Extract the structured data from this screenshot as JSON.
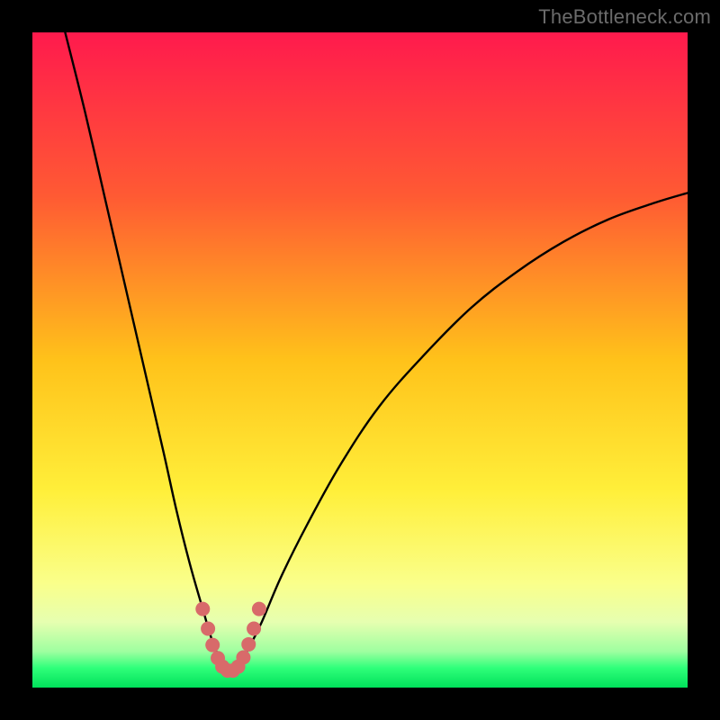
{
  "watermark": "TheBottleneck.com",
  "colors": {
    "frame": "#000000",
    "gradient_stops": [
      {
        "offset": 0.0,
        "color": "#ff1a4d"
      },
      {
        "offset": 0.25,
        "color": "#ff5a33"
      },
      {
        "offset": 0.5,
        "color": "#ffc21a"
      },
      {
        "offset": 0.7,
        "color": "#ffef3a"
      },
      {
        "offset": 0.84,
        "color": "#faff8a"
      },
      {
        "offset": 0.9,
        "color": "#e6ffb0"
      },
      {
        "offset": 0.945,
        "color": "#9effa0"
      },
      {
        "offset": 0.97,
        "color": "#2fff7a"
      },
      {
        "offset": 1.0,
        "color": "#00e05a"
      }
    ],
    "curve": "#000000",
    "dots": "#d86a6a"
  },
  "chart_data": {
    "type": "line",
    "title": "",
    "xlabel": "",
    "ylabel": "",
    "xlim": [
      0,
      100
    ],
    "ylim": [
      0,
      100
    ],
    "series": [
      {
        "name": "bottleneck-curve",
        "x": [
          5,
          8,
          11,
          14,
          17,
          20,
          22,
          24,
          26,
          27.5,
          29,
          30,
          31.5,
          33,
          35,
          38,
          42,
          47,
          53,
          60,
          67,
          74,
          81,
          88,
          95,
          100
        ],
        "y": [
          100,
          88,
          75,
          62,
          49,
          36,
          27,
          19,
          12,
          7,
          3.5,
          2.5,
          3.5,
          6,
          10,
          17,
          25,
          34,
          43,
          51,
          58,
          63.5,
          68,
          71.5,
          74,
          75.5
        ]
      }
    ],
    "dot_cluster": {
      "name": "bottleneck-range-dots",
      "points": [
        {
          "x": 26.0,
          "y": 12.0
        },
        {
          "x": 26.8,
          "y": 9.0
        },
        {
          "x": 27.5,
          "y": 6.5
        },
        {
          "x": 28.3,
          "y": 4.5
        },
        {
          "x": 29.0,
          "y": 3.2
        },
        {
          "x": 29.8,
          "y": 2.6
        },
        {
          "x": 30.6,
          "y": 2.6
        },
        {
          "x": 31.4,
          "y": 3.2
        },
        {
          "x": 32.2,
          "y": 4.6
        },
        {
          "x": 33.0,
          "y": 6.6
        },
        {
          "x": 33.8,
          "y": 9.0
        },
        {
          "x": 34.6,
          "y": 12.0
        }
      ]
    }
  }
}
